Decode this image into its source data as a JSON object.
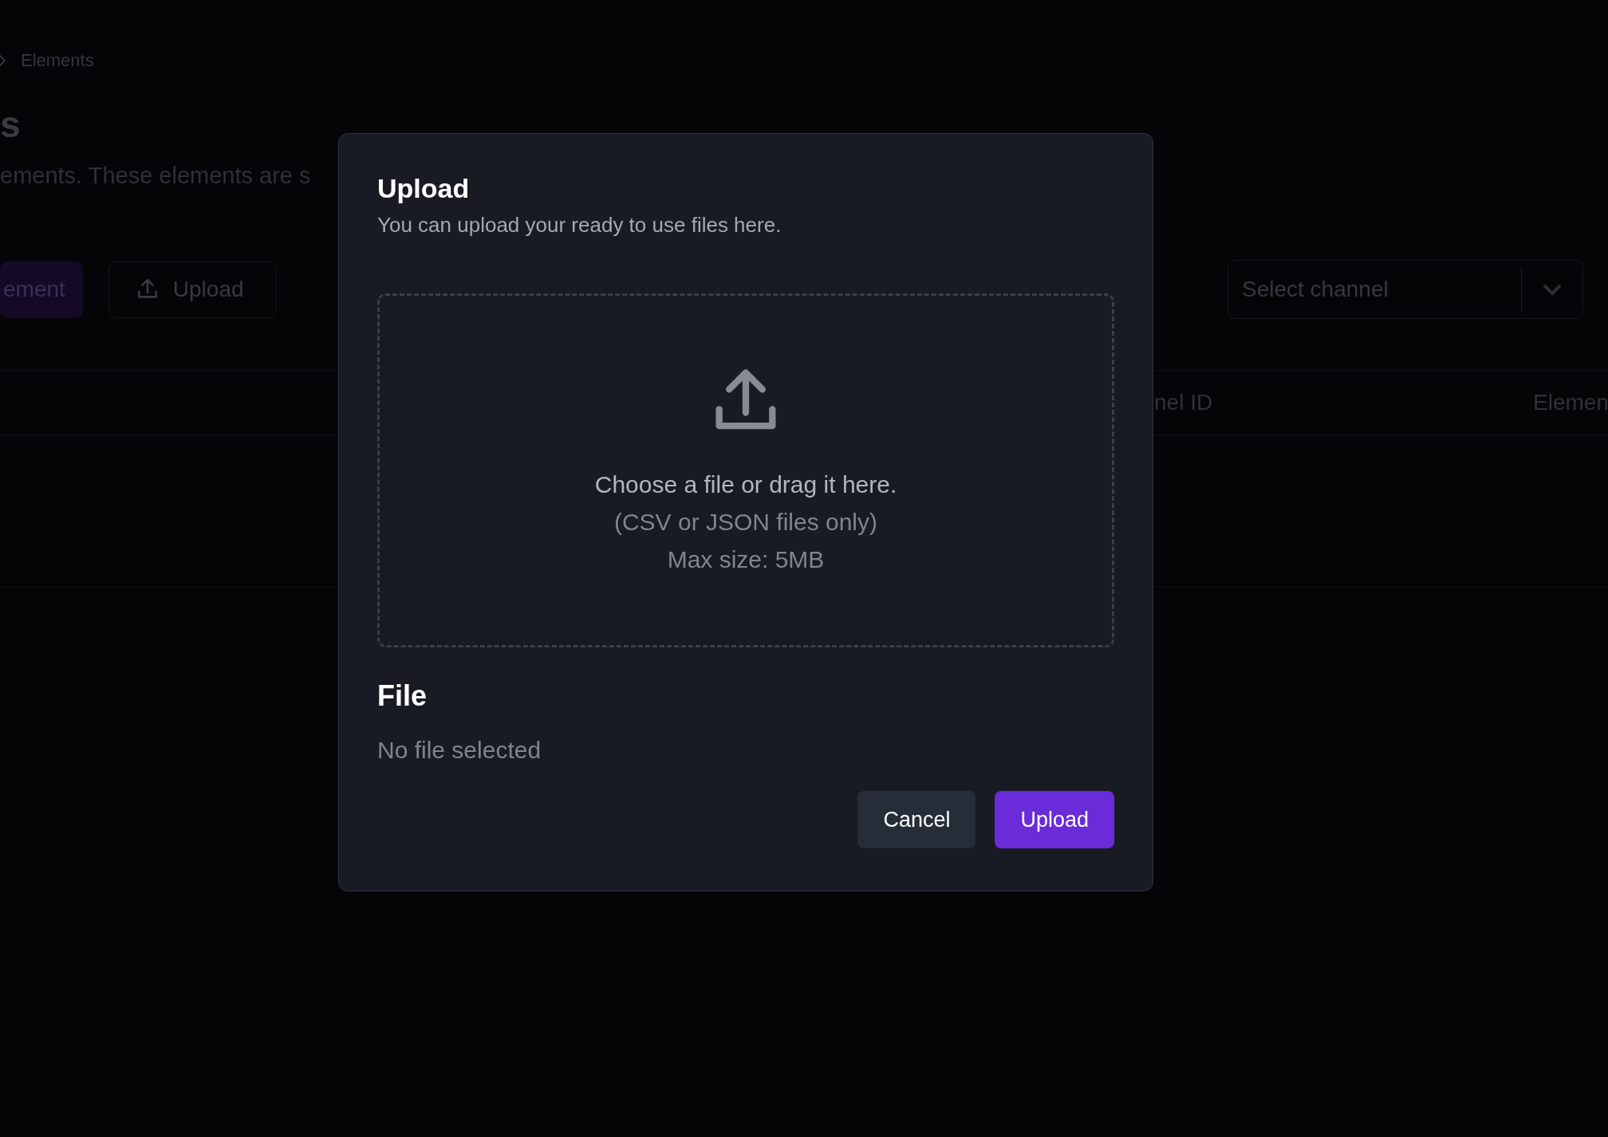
{
  "background_page": {
    "breadcrumb": "Elements",
    "title": "s",
    "subtitle": "ements. These elements are s",
    "buttons": [
      {
        "kind": "primary",
        "label": "ement"
      },
      {
        "kind": "upload",
        "label": "Upload"
      }
    ],
    "channel_select": {
      "placeholder": "Select channel"
    },
    "table": {
      "columns": [
        "nel ID",
        "Elemen"
      ]
    }
  },
  "dialog": {
    "title": "Upload",
    "description": "You can upload your ready to use files here.",
    "dropzone": {
      "prompt": "Choose a file or drag it here.",
      "formats": "(CSV or JSON files only)",
      "max_size": "Max size: 5MB"
    },
    "file_heading": "File",
    "file_status": "No file selected",
    "buttons": [
      {
        "kind": "secondary",
        "label": "Cancel"
      },
      {
        "kind": "primary",
        "label": "Upload"
      }
    ]
  }
}
